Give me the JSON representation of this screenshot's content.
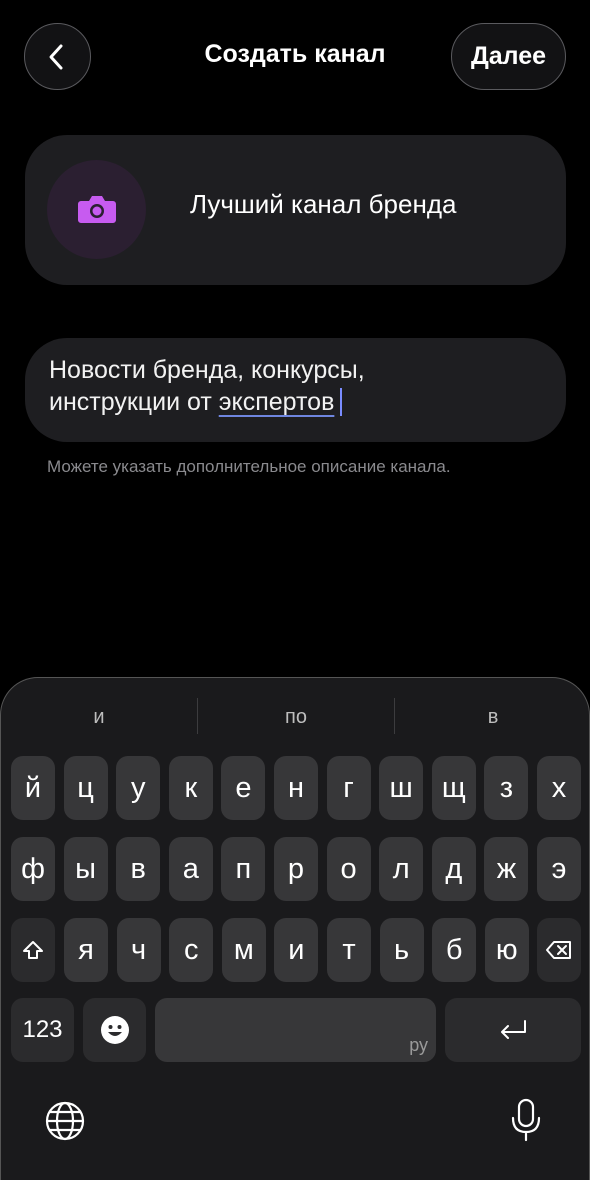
{
  "header": {
    "title": "Создать канал",
    "next_label": "Далее"
  },
  "channel": {
    "name": "Лучший канал бренда"
  },
  "description": {
    "line1": "Новости бренда, конкурсы,",
    "line2_prefix": "инструкции от ",
    "line2_word": "экспертов",
    "hint": "Можете указать дополнительное описание канала."
  },
  "keyboard": {
    "suggestions": [
      "и",
      "по",
      "в"
    ],
    "row1": [
      "й",
      "ц",
      "у",
      "к",
      "е",
      "н",
      "г",
      "ш",
      "щ",
      "з",
      "х"
    ],
    "row2": [
      "ф",
      "ы",
      "в",
      "а",
      "п",
      "р",
      "о",
      "л",
      "д",
      "ж",
      "э"
    ],
    "row3": [
      "я",
      "ч",
      "с",
      "м",
      "и",
      "т",
      "ь",
      "б",
      "ю"
    ],
    "numbers_label": "123",
    "space_lang": "ру"
  },
  "colors": {
    "accent_icon": "#c75bf0",
    "background": "#000000",
    "card": "#1e1e21"
  },
  "icons": [
    "chevron-left-icon",
    "camera-icon",
    "shift-icon",
    "backspace-icon",
    "emoji-icon",
    "enter-icon",
    "globe-icon",
    "microphone-icon"
  ]
}
